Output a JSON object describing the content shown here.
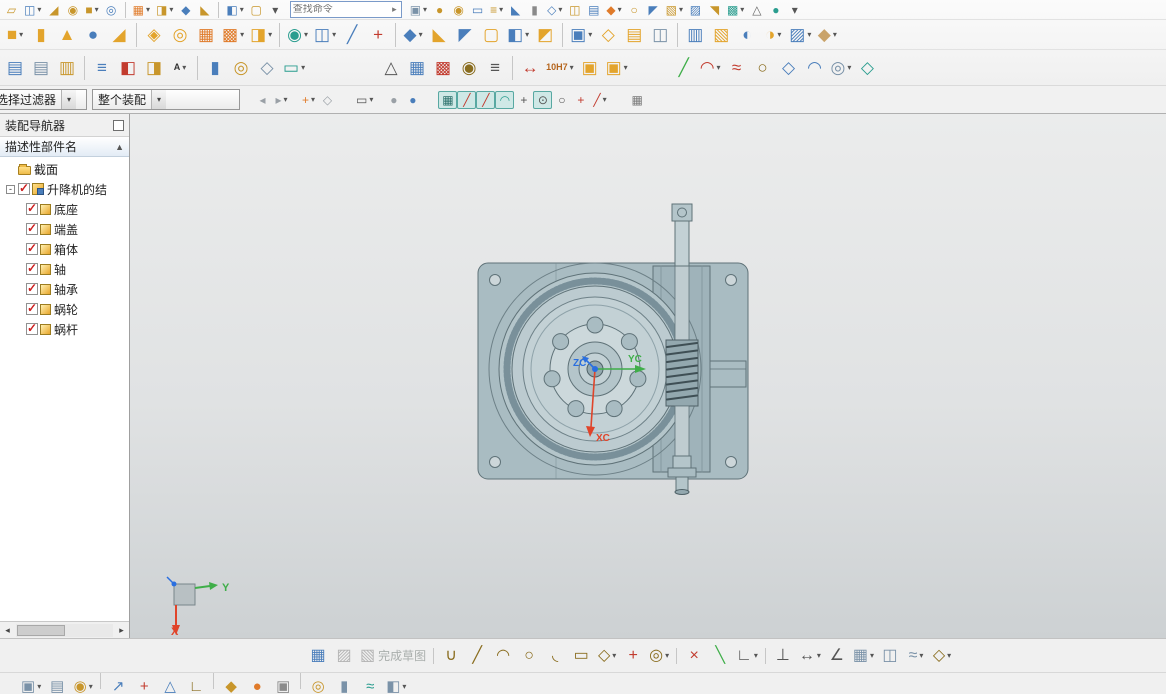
{
  "toolbars": {
    "search": {
      "placeholder": "查找命令"
    },
    "rows": [
      {
        "name": "quick-access-toolbar",
        "size": "sm",
        "items": [
          {
            "n": "create-sketch-mini",
            "g": "▱",
            "c": "#c8962b"
          },
          {
            "n": "datum-plane-mini",
            "g": "◫",
            "c": "#4a7ebb",
            "caret": true
          },
          {
            "n": "extrude-mini",
            "g": "◢",
            "c": "#c8962b"
          },
          {
            "n": "revolve-mini",
            "g": "◉",
            "c": "#c8962b"
          },
          {
            "n": "block-mini",
            "g": "■",
            "c": "#c8962b",
            "caret": true
          },
          {
            "n": "hole-mini",
            "g": "◎",
            "c": "#4a7ebb"
          },
          {
            "type": "sep"
          },
          {
            "n": "pattern-feature-mini",
            "g": "▦",
            "c": "#e07b2a",
            "caret": true
          },
          {
            "n": "unite-mini",
            "g": "◨",
            "c": "#c8962b",
            "caret": true
          },
          {
            "n": "edge-blend-mini",
            "g": "◆",
            "c": "#4a7ebb"
          },
          {
            "n": "chamfer-mini",
            "g": "◣",
            "c": "#c8962b"
          },
          {
            "type": "sep"
          },
          {
            "n": "trim-body-mini",
            "g": "◧",
            "c": "#4a7ebb",
            "caret": true
          },
          {
            "n": "shell-mini",
            "g": "▢",
            "c": "#c8962b"
          },
          {
            "n": "more-feature-mini",
            "g": "▾",
            "c": "#555555"
          },
          {
            "type": "search"
          },
          {
            "n": "feature-group-mini",
            "g": "▣",
            "c": "#7a92a8",
            "caret": true
          },
          {
            "n": "sphere-mini",
            "g": "●",
            "c": "#c8962b"
          },
          {
            "n": "boss-mini",
            "g": "◉",
            "c": "#c8962b"
          },
          {
            "n": "pocket-mini",
            "g": "▭",
            "c": "#4a7ebb"
          },
          {
            "n": "rib-mini",
            "g": "≡",
            "c": "#c8962b",
            "caret": true
          },
          {
            "n": "draft-mini",
            "g": "◣",
            "c": "#4a7ebb"
          },
          {
            "n": "thread-mini",
            "g": "▮",
            "c": "#8a8a8a"
          },
          {
            "n": "sew-mini",
            "g": "◇",
            "c": "#4a7ebb",
            "caret": true
          },
          {
            "n": "patch-mini",
            "g": "◫",
            "c": "#c8962b"
          },
          {
            "n": "thicken-mini",
            "g": "▤",
            "c": "#4a7ebb"
          },
          {
            "n": "scale-body-mini",
            "g": "◆",
            "c": "#e07b2a",
            "caret": true
          },
          {
            "n": "wrap-geometry-mini",
            "g": "○",
            "c": "#c8962b"
          },
          {
            "n": "split-body-mini",
            "g": "◤",
            "c": "#4a7ebb"
          },
          {
            "n": "delete-face-mini",
            "g": "▧",
            "c": "#c8962b",
            "caret": true
          },
          {
            "n": "move-face-mini",
            "g": "▨",
            "c": "#4a7ebb"
          },
          {
            "n": "replace-face-mini",
            "g": "◥",
            "c": "#c8962b"
          },
          {
            "n": "synchronous-mini",
            "g": "▩",
            "c": "#2a9d8f",
            "caret": true
          },
          {
            "n": "measure-mini",
            "g": "△",
            "c": "#666666"
          },
          {
            "n": "roles-mini",
            "g": "●",
            "c": "#2a9d8f"
          },
          {
            "n": "more-mini",
            "g": "▾",
            "c": "#555555"
          }
        ]
      },
      {
        "name": "feature-toolbar",
        "size": "lg",
        "items": [
          {
            "n": "block",
            "g": "■",
            "c": "#e3a42c",
            "caret": true
          },
          {
            "n": "cylinder",
            "g": "▮",
            "c": "#e3a42c"
          },
          {
            "n": "cone",
            "g": "▲",
            "c": "#e3a42c"
          },
          {
            "n": "sphere",
            "g": "●",
            "c": "#4a7ebb"
          },
          {
            "n": "extrude",
            "g": "◢",
            "c": "#e3a42c"
          },
          {
            "type": "sep"
          },
          {
            "n": "swept",
            "g": "◈",
            "c": "#e3a42c"
          },
          {
            "n": "hole",
            "g": "◎",
            "c": "#e3a42c"
          },
          {
            "n": "pattern-feature",
            "g": "▦",
            "c": "#e07b2a"
          },
          {
            "n": "pattern-geometry",
            "g": "▩",
            "c": "#e07b2a",
            "caret": true
          },
          {
            "n": "unite",
            "g": "◨",
            "c": "#e3a42c",
            "caret": true
          },
          {
            "type": "sep"
          },
          {
            "n": "point",
            "g": "◉",
            "c": "#2a9d8f",
            "caret": true
          },
          {
            "n": "datum-plane",
            "g": "◫",
            "c": "#4a7ebb",
            "caret": true
          },
          {
            "n": "datum-axis",
            "g": "╱",
            "c": "#4a7ebb"
          },
          {
            "n": "datum-csys",
            "g": "+",
            "c": "#c23b2e"
          },
          {
            "type": "sep"
          },
          {
            "n": "edge-blend",
            "g": "◆",
            "c": "#4a7ebb",
            "caret": true
          },
          {
            "n": "chamfer",
            "g": "◣",
            "c": "#e3a42c"
          },
          {
            "n": "draft",
            "g": "◤",
            "c": "#4a7ebb"
          },
          {
            "n": "shell",
            "g": "▢",
            "c": "#e3a42c"
          },
          {
            "n": "trim-body",
            "g": "◧",
            "c": "#4a7ebb",
            "caret": true
          },
          {
            "n": "split-body",
            "g": "◩",
            "c": "#e3a42c"
          },
          {
            "type": "sep"
          },
          {
            "n": "assembly-constraints",
            "g": "▣",
            "c": "#4a7ebb",
            "caret": true
          },
          {
            "n": "move-component",
            "g": "◇",
            "c": "#e3a42c"
          },
          {
            "n": "add-component",
            "g": "▤",
            "c": "#e3a42c"
          },
          {
            "n": "mirror-assembly",
            "g": "◫",
            "c": "#7a92a8"
          },
          {
            "type": "sep"
          },
          {
            "n": "wave-geometry-linker",
            "g": "▥",
            "c": "#4a7ebb"
          },
          {
            "n": "promote-body",
            "g": "▧",
            "c": "#e3a42c"
          },
          {
            "n": "bounded-plane",
            "g": "◐",
            "c": "#4a7ebb"
          },
          {
            "n": "through-curves",
            "g": "◑",
            "c": "#e3a42c",
            "caret": true
          },
          {
            "n": "studio-surface",
            "g": "▨",
            "c": "#4a7ebb",
            "caret": true
          },
          {
            "n": "more-surface",
            "g": "◆",
            "c": "#c9a36a",
            "caret": true
          }
        ]
      },
      {
        "name": "utility-toolbar",
        "size": "lg",
        "items": [
          {
            "n": "extract-geometry",
            "g": "▤",
            "c": "#4a7ebb"
          },
          {
            "n": "linked-body",
            "g": "▤",
            "c": "#7a92a8"
          },
          {
            "n": "journal",
            "g": "▥",
            "c": "#c8962b"
          },
          {
            "type": "sep"
          },
          {
            "n": "expressions",
            "g": "≡",
            "c": "#4a7ebb"
          },
          {
            "n": "edit-display",
            "g": "◧",
            "c": "#c23b2e"
          },
          {
            "n": "object-display",
            "g": "◨",
            "c": "#c8962b"
          },
          {
            "n": "annotation",
            "text": "A",
            "c": "#333333",
            "caret": true
          },
          {
            "type": "sep"
          },
          {
            "n": "spring-tool",
            "g": "▮",
            "c": "#4a7ebb"
          },
          {
            "n": "cable-tool",
            "g": "◎",
            "c": "#c8962b"
          },
          {
            "n": "measure-body",
            "g": "◇",
            "c": "#7a92a8"
          },
          {
            "n": "section-tool",
            "g": "▭",
            "c": "#2a9d8f",
            "caret": true
          },
          {
            "type": "gap",
            "w": 70
          },
          {
            "n": "tolerance-datum",
            "g": "△",
            "c": "#555555"
          },
          {
            "n": "part-family-table",
            "g": "▦",
            "c": "#4a7ebb"
          },
          {
            "n": "feature-tag",
            "g": "▩",
            "c": "#c23b2e"
          },
          {
            "n": "bolt-hole-table",
            "g": "◉",
            "c": "#8a6d1f"
          },
          {
            "n": "note-editor",
            "g": "≡",
            "c": "#555555"
          },
          {
            "type": "sep"
          },
          {
            "n": "dimension-style",
            "g": "↔",
            "c": "#c23b2e"
          },
          {
            "n": "limits-and-fits",
            "text": "10H7",
            "c": "#b5651d",
            "caret": true
          },
          {
            "n": "stack-tolerance",
            "g": "▣",
            "c": "#e3a42c"
          },
          {
            "n": "stack-analysis",
            "g": "▣",
            "c": "#e3a42c",
            "caret": true
          },
          {
            "type": "gap",
            "w": 40
          },
          {
            "n": "line-curve",
            "g": "╱",
            "c": "#3fae49"
          },
          {
            "n": "arc-curve",
            "g": "◠",
            "c": "#c23b2e",
            "caret": true
          },
          {
            "n": "studio-spline",
            "g": "≈",
            "c": "#c23b2e"
          },
          {
            "n": "closed-curve",
            "g": "○",
            "c": "#8a6d1f"
          },
          {
            "n": "surface-patch",
            "g": "◇",
            "c": "#4a7ebb"
          },
          {
            "n": "bridge-curve",
            "g": "◠",
            "c": "#4a7ebb"
          },
          {
            "n": "helix-curve",
            "g": "◎",
            "c": "#7a92a8",
            "caret": true
          },
          {
            "n": "more-curve",
            "g": "◇",
            "c": "#2a9d8f"
          }
        ]
      }
    ]
  },
  "filter_bar": {
    "selection_filter": "选择过滤器",
    "scope": "整个装配",
    "items": [
      {
        "type": "gap",
        "w": 8
      },
      {
        "n": "filter-back",
        "g": "◂",
        "c": "#9aa0a6"
      },
      {
        "n": "filter-forward",
        "g": "▸",
        "c": "#9aa0a6",
        "caret": true
      },
      {
        "type": "gap",
        "w": 8
      },
      {
        "n": "snap-handles",
        "g": "+",
        "c": "#e07b2a",
        "caret": true
      },
      {
        "n": "selection-scope",
        "g": "◇",
        "c": "#9aa0a6"
      },
      {
        "type": "gap",
        "w": 16
      },
      {
        "n": "rectangle-select",
        "g": "▭",
        "c": "#555555",
        "caret": true
      },
      {
        "type": "gap",
        "w": 8
      },
      {
        "n": "highlight-gray-ball",
        "g": "●",
        "c": "#9aa0a6"
      },
      {
        "n": "highlight-blue-ball",
        "g": "●",
        "c": "#4a7ebb"
      },
      {
        "type": "gap",
        "w": 16
      },
      {
        "n": "snap-grid-point",
        "g": "▦",
        "c": "#2a6f6a",
        "pressed": true
      },
      {
        "n": "snap-endpoint",
        "g": "╱",
        "c": "#c23b2e",
        "pressed": true
      },
      {
        "n": "snap-midpoint",
        "g": "╱",
        "c": "#c23b2e",
        "pressed": true
      },
      {
        "n": "snap-point-on-curve",
        "g": "◠",
        "c": "#2a9d8f",
        "pressed": true
      },
      {
        "n": "snap-intersection",
        "g": "+",
        "c": "#555555"
      },
      {
        "n": "snap-arc-center",
        "g": "⊙",
        "c": "#555555",
        "pressed": true
      },
      {
        "n": "snap-quadrant-point",
        "g": "○",
        "c": "#555555"
      },
      {
        "n": "snap-existing-point",
        "g": "+",
        "c": "#c23b2e"
      },
      {
        "n": "snap-point-on-face",
        "g": "╱",
        "c": "#c23b2e",
        "caret": true
      },
      {
        "type": "gap",
        "w": 18
      },
      {
        "n": "work-plane-grid",
        "g": "▦",
        "c": "#7a7a7a"
      }
    ]
  },
  "navigator": {
    "title": "装配导航器",
    "column_header": "描述性部件名",
    "sort_indicator": "▲",
    "tree": [
      {
        "label": "截面",
        "icon": "folder",
        "level": 1,
        "checkbox": false
      },
      {
        "label": "升降机的结",
        "icon": "assembly",
        "level": 1,
        "checkbox": true,
        "expander": "-"
      },
      {
        "label": "底座",
        "icon": "part",
        "level": 2,
        "checkbox": true
      },
      {
        "label": "端盖",
        "icon": "part",
        "level": 2,
        "checkbox": true
      },
      {
        "label": "箱体",
        "icon": "part",
        "level": 2,
        "checkbox": true
      },
      {
        "label": "轴",
        "icon": "part",
        "level": 2,
        "checkbox": true
      },
      {
        "label": "轴承",
        "icon": "part",
        "level": 2,
        "checkbox": true
      },
      {
        "label": "蜗轮",
        "icon": "part",
        "level": 2,
        "checkbox": true
      },
      {
        "label": "蜗杆",
        "icon": "part",
        "level": 2,
        "checkbox": true
      }
    ]
  },
  "viewport": {
    "axes": {
      "zc": "ZC",
      "yc": "YC",
      "xc": "XC"
    },
    "triad": {
      "x": "X",
      "y": "Y"
    },
    "colors": {
      "x_axis": "#e0442a",
      "y_axis": "#3fae49",
      "z_axis": "#2a6fe0",
      "body": "#a9bcc2",
      "outline": "#5f7278"
    }
  },
  "sketch_bar": {
    "items": [
      {
        "n": "oriented-sketch-view",
        "g": "▦",
        "c": "#4a7ebb"
      },
      {
        "n": "sketch-preferences",
        "g": "▨",
        "c": "#9aa0a6",
        "gray": true
      },
      {
        "n": "finish-sketch",
        "g": "▧",
        "gray": true,
        "label": "完成草图"
      },
      {
        "type": "sep"
      },
      {
        "n": "profile",
        "g": "∪",
        "c": "#8a6d1f"
      },
      {
        "n": "line",
        "g": "╱",
        "c": "#8a6d1f"
      },
      {
        "n": "arc",
        "g": "◠",
        "c": "#8a6d1f"
      },
      {
        "n": "circle",
        "g": "○",
        "c": "#8a6d1f"
      },
      {
        "n": "fillet",
        "g": "◟",
        "c": "#8a6d1f"
      },
      {
        "n": "rectangle",
        "g": "▭",
        "c": "#8a6d1f"
      },
      {
        "n": "polygon",
        "g": "◇",
        "c": "#8a6d1f",
        "caret": true
      },
      {
        "n": "point",
        "g": "+",
        "c": "#c23b2e"
      },
      {
        "n": "offset-curve",
        "g": "◎",
        "c": "#8a6d1f",
        "caret": true
      },
      {
        "type": "sep"
      },
      {
        "n": "quick-trim",
        "g": "×",
        "c": "#c23b2e"
      },
      {
        "n": "quick-extend",
        "g": "╲",
        "c": "#3fae49"
      },
      {
        "n": "make-corner",
        "g": "∟",
        "c": "#555555",
        "caret": true
      },
      {
        "type": "sep"
      },
      {
        "n": "geometric-constraints",
        "g": "⊥",
        "c": "#555555"
      },
      {
        "n": "auto-dimension",
        "g": "↔",
        "c": "#555555",
        "caret": true
      },
      {
        "n": "angle-dimension",
        "g": "∠",
        "c": "#555555"
      },
      {
        "n": "sketch-pattern",
        "g": "▦",
        "c": "#7a92a8",
        "caret": true
      },
      {
        "n": "mirror-curve",
        "g": "◫",
        "c": "#7a92a8"
      },
      {
        "n": "offset-sketch",
        "g": "≈",
        "c": "#7a92a8",
        "caret": true
      },
      {
        "n": "more-sketch",
        "g": "◇",
        "c": "#8a6d1f",
        "caret": true
      }
    ]
  },
  "bottom_bar": {
    "items": [
      {
        "n": "assembly-arrangement",
        "g": "▣",
        "c": "#7a92a8",
        "caret": true
      },
      {
        "n": "exploded-view",
        "g": "▤",
        "c": "#7a92a8"
      },
      {
        "n": "add-component-bottom",
        "g": "◉",
        "c": "#c8962b",
        "caret": true
      },
      {
        "type": "sep"
      },
      {
        "n": "move-bottom",
        "g": "↗",
        "c": "#4a7ebb"
      },
      {
        "n": "csys-bottom",
        "g": "+",
        "c": "#c23b2e"
      },
      {
        "n": "mirror-bottom",
        "g": "△",
        "c": "#4a7ebb"
      },
      {
        "n": "measure-bottom",
        "g": "∟",
        "c": "#8a6d1f"
      },
      {
        "type": "sep"
      },
      {
        "n": "pattern-bottom",
        "g": "◆",
        "c": "#c8962b"
      },
      {
        "n": "sphere-bottom",
        "g": "●",
        "c": "#e07b2a"
      },
      {
        "n": "block-bottom",
        "g": "▣",
        "c": "#8a8a8a"
      },
      {
        "type": "sep"
      },
      {
        "n": "spring-bottom",
        "g": "◎",
        "c": "#c8962b"
      },
      {
        "n": "tube-bottom",
        "g": "▮",
        "c": "#7a92a8"
      },
      {
        "n": "route-bottom",
        "g": "≈",
        "c": "#2a9d8f"
      },
      {
        "n": "solid-bottom",
        "g": "◧",
        "c": "#7a92a8",
        "caret": true
      }
    ]
  }
}
